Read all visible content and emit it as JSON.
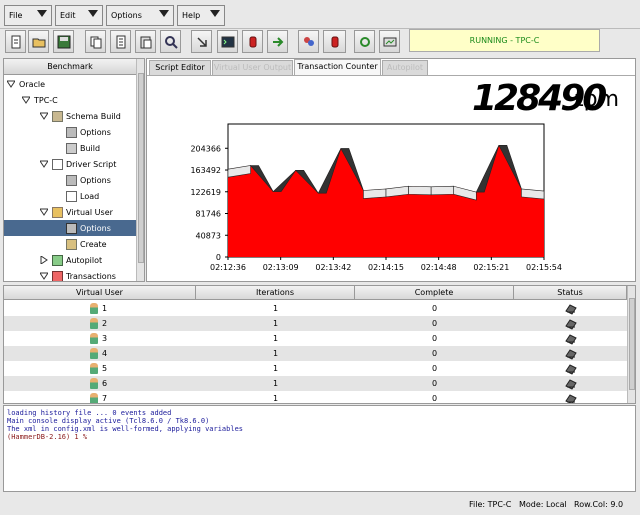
{
  "menus": [
    {
      "label": "File",
      "key": "F"
    },
    {
      "label": "Edit",
      "key": "E"
    },
    {
      "label": "Options",
      "key": "O"
    },
    {
      "label": "Help",
      "key": "H"
    }
  ],
  "status": {
    "text": "RUNNING - TPC-C",
    "color": "#1a8a1a"
  },
  "tree": {
    "header": "Benchmark",
    "items": [
      {
        "label": "Oracle"
      },
      {
        "label": "TPC-C"
      },
      {
        "label": "Schema Build"
      },
      {
        "label": "Options"
      },
      {
        "label": "Build"
      },
      {
        "label": "Driver Script"
      },
      {
        "label": "Options"
      },
      {
        "label": "Load"
      },
      {
        "label": "Virtual User"
      },
      {
        "label": "Options"
      },
      {
        "label": "Create"
      },
      {
        "label": "Autopilot"
      },
      {
        "label": "Transactions"
      }
    ]
  },
  "tabs": [
    {
      "label": "Script Editor"
    },
    {
      "label": "Virtual User Output"
    },
    {
      "label": "Transaction Counter"
    },
    {
      "label": "Autopilot"
    }
  ],
  "counter": {
    "value": "128490",
    "unit": "tpm"
  },
  "chart_data": {
    "type": "area",
    "ylim": [
      0,
      250000
    ],
    "yticks": [
      "204366",
      "163492",
      "122619",
      "81746",
      "40873",
      "0"
    ],
    "xticks": [
      "02:12:36",
      "02:13:09",
      "02:13:42",
      "02:14:15",
      "02:14:48",
      "02:15:21",
      "02:15:54"
    ],
    "series": [
      {
        "values": [
          165000,
          172000,
          123000,
          163000,
          120000,
          204000,
          125000,
          128000,
          133000,
          132000,
          133000,
          122000,
          210000,
          128000,
          124000
        ]
      }
    ],
    "colors": {
      "fill": "#ff0000",
      "top": "#e8e8e8",
      "dark": "#333333"
    }
  },
  "grid": {
    "columns": [
      "Virtual User",
      "Iterations",
      "Complete",
      "Status"
    ],
    "rows": [
      {
        "user": "1",
        "iterations": "1",
        "complete": "0"
      },
      {
        "user": "2",
        "iterations": "1",
        "complete": "0"
      },
      {
        "user": "3",
        "iterations": "1",
        "complete": "0"
      },
      {
        "user": "4",
        "iterations": "1",
        "complete": "0"
      },
      {
        "user": "5",
        "iterations": "1",
        "complete": "0"
      },
      {
        "user": "6",
        "iterations": "1",
        "complete": "0"
      },
      {
        "user": "7",
        "iterations": "1",
        "complete": "0"
      }
    ]
  },
  "console": {
    "lines": [
      "loading history file ... 0 events added",
      "Main console display active (Tcl8.6.0 / Tk8.6.0)",
      "The xml in config.xml is well-formed, applying variables",
      "(HammerDB-2.16) 1 %"
    ]
  },
  "statusbar": {
    "file": "File: TPC-C",
    "mode": "Mode: Local",
    "rowcol": "Row.Col:  9.0"
  }
}
